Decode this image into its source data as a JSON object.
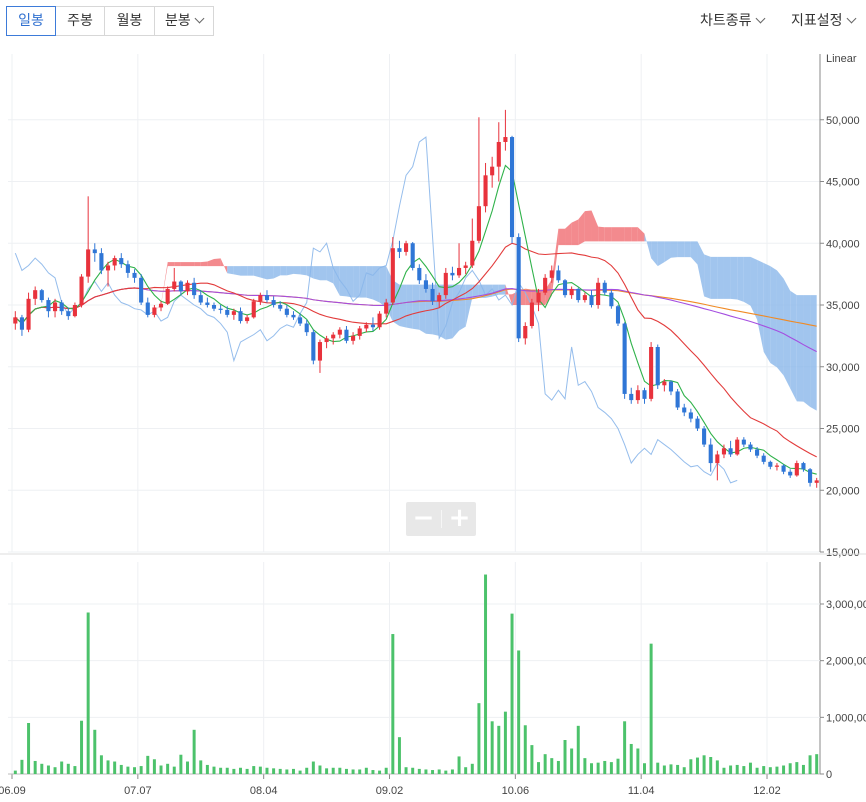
{
  "toolbar": {
    "periods": [
      "일봉",
      "주봉",
      "월봉",
      "분봉"
    ],
    "active_period": "일봉",
    "chart_type_label": "차트종류",
    "indicator_label": "지표설정"
  },
  "zoom": {
    "minus_label": "−",
    "plus_label": "+"
  },
  "colors": {
    "up": "#e8323c",
    "down": "#2f76d6",
    "volume": "#4cc26b",
    "ma5": "#2fb24a",
    "ma20": "#e23b3b",
    "ma60": "#a44ee0",
    "ma120": "#f08a24",
    "cloud_blue": "#8ab6ea",
    "cloud_red": "#f06d72",
    "grid": "#eef0f3"
  },
  "chart_data": [
    {
      "type": "candlestick",
      "scale_label": "Linear",
      "y_ticks": [
        "50,000",
        "45,000",
        "40,000",
        "35,000",
        "30,000",
        "25,000",
        "20,000",
        "15,000"
      ],
      "ylim": [
        15000,
        55000
      ],
      "x_tick_labels": [
        "06.09",
        "07.07",
        "08.04",
        "09.02",
        "10.06",
        "11.04",
        "12.02"
      ],
      "candles": [
        [
          0,
          33500,
          34500,
          33000,
          34000
        ],
        [
          1,
          34000,
          34200,
          32500,
          33000
        ],
        [
          2,
          33000,
          36000,
          32800,
          35500
        ],
        [
          3,
          35500,
          36500,
          35000,
          36200
        ],
        [
          4,
          36200,
          36300,
          35200,
          35400
        ],
        [
          5,
          35400,
          35600,
          34000,
          34500
        ],
        [
          6,
          34500,
          35500,
          34000,
          35200
        ],
        [
          7,
          35200,
          35400,
          34200,
          34500
        ],
        [
          8,
          34500,
          34800,
          33800,
          34100
        ],
        [
          9,
          34100,
          35200,
          34000,
          35000
        ],
        [
          10,
          35000,
          37500,
          34800,
          37300
        ],
        [
          11,
          37300,
          43800,
          36800,
          39500
        ],
        [
          12,
          39500,
          40000,
          38500,
          39200
        ],
        [
          13,
          39200,
          39600,
          37500,
          37800
        ],
        [
          14,
          37800,
          38500,
          36500,
          38200
        ],
        [
          15,
          38200,
          39000,
          37800,
          38800
        ],
        [
          16,
          38800,
          39200,
          38000,
          38300
        ],
        [
          17,
          38300,
          38600,
          37200,
          37600
        ],
        [
          18,
          37600,
          37900,
          36800,
          37200
        ],
        [
          19,
          37200,
          37500,
          35000,
          35200
        ],
        [
          20,
          35200,
          35600,
          34000,
          34200
        ],
        [
          21,
          34200,
          35000,
          34000,
          34800
        ],
        [
          22,
          34800,
          35300,
          34500,
          35100
        ],
        [
          23,
          35100,
          36500,
          35000,
          36300
        ],
        [
          24,
          36300,
          38000,
          36100,
          36900
        ],
        [
          25,
          36900,
          37000,
          35800,
          36100
        ],
        [
          26,
          36100,
          37000,
          35800,
          36800
        ],
        [
          27,
          36800,
          37200,
          35500,
          35800
        ],
        [
          28,
          35800,
          36200,
          35000,
          35200
        ],
        [
          29,
          35200,
          35600,
          34800,
          35000
        ],
        [
          30,
          35000,
          35200,
          34500,
          34700
        ],
        [
          31,
          34700,
          35000,
          34300,
          34600
        ],
        [
          32,
          34600,
          34900,
          34000,
          34200
        ],
        [
          33,
          34200,
          34700,
          33800,
          34500
        ],
        [
          34,
          34500,
          34800,
          33500,
          33700
        ],
        [
          35,
          33700,
          34200,
          33500,
          34000
        ],
        [
          36,
          34000,
          35500,
          33900,
          35300
        ],
        [
          37,
          35300,
          36000,
          35000,
          35800
        ],
        [
          38,
          35800,
          36200,
          35200,
          35400
        ],
        [
          39,
          35400,
          35700,
          34800,
          35000
        ],
        [
          40,
          35000,
          35300,
          34500,
          34700
        ],
        [
          41,
          34700,
          35000,
          34000,
          34200
        ],
        [
          42,
          34200,
          34500,
          33800,
          34000
        ],
        [
          43,
          34000,
          34300,
          33300,
          33500
        ],
        [
          44,
          33500,
          33800,
          32500,
          32800
        ],
        [
          45,
          32800,
          33000,
          30200,
          30500
        ],
        [
          46,
          30500,
          32200,
          29500,
          32000
        ],
        [
          47,
          32000,
          32500,
          31500,
          32300
        ],
        [
          48,
          32300,
          32800,
          31800,
          32600
        ],
        [
          49,
          32600,
          33200,
          32300,
          33000
        ],
        [
          50,
          33000,
          33300,
          31900,
          32100
        ],
        [
          51,
          32100,
          32800,
          31800,
          32500
        ],
        [
          52,
          32500,
          33300,
          32200,
          33100
        ],
        [
          53,
          33100,
          33600,
          32800,
          33400
        ],
        [
          54,
          33400,
          34000,
          32900,
          33200
        ],
        [
          55,
          33200,
          34500,
          33000,
          34300
        ],
        [
          56,
          34300,
          35500,
          34000,
          35200
        ],
        [
          57,
          35200,
          40500,
          35000,
          39600
        ],
        [
          58,
          39600,
          40200,
          38800,
          39300
        ],
        [
          59,
          39300,
          40200,
          39000,
          40000
        ],
        [
          60,
          40000,
          40100,
          37800,
          38000
        ],
        [
          61,
          38000,
          38300,
          36700,
          37000
        ],
        [
          62,
          37000,
          37500,
          36000,
          36300
        ],
        [
          63,
          36300,
          36800,
          35000,
          35300
        ],
        [
          64,
          35300,
          36000,
          34800,
          35800
        ],
        [
          65,
          35800,
          38000,
          35500,
          37600
        ],
        [
          66,
          37600,
          38100,
          37000,
          37400
        ],
        [
          67,
          37400,
          40000,
          37200,
          38000
        ],
        [
          68,
          38000,
          38500,
          37500,
          38200
        ],
        [
          69,
          38200,
          42000,
          38000,
          40200
        ],
        [
          70,
          40200,
          50200,
          40000,
          43000
        ],
        [
          71,
          43000,
          46500,
          42500,
          45500
        ],
        [
          72,
          45500,
          47000,
          44500,
          46200
        ],
        [
          73,
          46200,
          49800,
          45000,
          48200
        ],
        [
          74,
          48200,
          50800,
          47500,
          48600
        ],
        [
          75,
          48600,
          48700,
          40000,
          40500
        ],
        [
          76,
          40500,
          40800,
          32000,
          32300
        ],
        [
          77,
          32300,
          33600,
          31800,
          33300
        ],
        [
          78,
          33300,
          35500,
          33100,
          35200
        ],
        [
          79,
          35200,
          36300,
          34500,
          36000
        ],
        [
          80,
          36000,
          37500,
          35800,
          37200
        ],
        [
          81,
          37200,
          38200,
          36800,
          37800
        ],
        [
          82,
          37800,
          38200,
          36800,
          37000
        ],
        [
          83,
          37000,
          37100,
          35600,
          35800
        ],
        [
          84,
          35800,
          36500,
          35500,
          36300
        ],
        [
          85,
          36300,
          36400,
          35200,
          35400
        ],
        [
          86,
          35400,
          36000,
          35200,
          35800
        ],
        [
          87,
          35800,
          36200,
          34800,
          35000
        ],
        [
          88,
          35000,
          37200,
          34700,
          36800
        ],
        [
          89,
          36800,
          37000,
          35800,
          36000
        ],
        [
          90,
          36000,
          36200,
          34700,
          34900
        ],
        [
          91,
          34900,
          35000,
          33300,
          33500
        ],
        [
          92,
          33500,
          33600,
          27400,
          27800
        ],
        [
          93,
          27800,
          28300,
          27000,
          27300
        ],
        [
          94,
          27300,
          28500,
          27000,
          28100
        ],
        [
          95,
          28100,
          28300,
          27000,
          27400
        ],
        [
          96,
          27400,
          32000,
          27200,
          31600
        ],
        [
          97,
          31600,
          31800,
          28200,
          28500
        ],
        [
          98,
          28500,
          29000,
          28000,
          28800
        ],
        [
          99,
          28800,
          28900,
          27700,
          28000
        ],
        [
          100,
          28000,
          28200,
          26500,
          26700
        ],
        [
          101,
          26700,
          27000,
          26000,
          26300
        ],
        [
          102,
          26300,
          26600,
          25500,
          25800
        ],
        [
          103,
          25800,
          26000,
          24800,
          25000
        ],
        [
          104,
          25000,
          25200,
          23500,
          23700
        ],
        [
          105,
          23700,
          24200,
          21500,
          22200
        ],
        [
          106,
          22200,
          23200,
          20800,
          22900
        ],
        [
          107,
          22900,
          23700,
          22600,
          23400
        ],
        [
          108,
          23400,
          24000,
          22700,
          22900
        ],
        [
          109,
          22900,
          24300,
          22800,
          24100
        ],
        [
          110,
          24100,
          24300,
          23500,
          23700
        ],
        [
          111,
          23700,
          23900,
          23100,
          23300
        ],
        [
          112,
          23300,
          23500,
          22600,
          22800
        ],
        [
          113,
          22800,
          23000,
          22100,
          22300
        ],
        [
          114,
          22300,
          22400,
          21700,
          21900
        ],
        [
          115,
          21900,
          22200,
          21600,
          22000
        ],
        [
          116,
          22000,
          22100,
          21300,
          21500
        ],
        [
          117,
          21500,
          21700,
          21000,
          21200
        ],
        [
          118,
          21200,
          22400,
          21100,
          22200
        ],
        [
          119,
          22200,
          22300,
          21500,
          21700
        ],
        [
          120,
          21700,
          21800,
          20300,
          20600
        ],
        [
          121,
          20600,
          21000,
          20200,
          20800
        ]
      ],
      "volumes": [
        60,
        250,
        900,
        230,
        180,
        150,
        120,
        220,
        180,
        140,
        940,
        2850,
        780,
        330,
        240,
        220,
        160,
        130,
        120,
        140,
        320,
        260,
        150,
        180,
        130,
        340,
        220,
        780,
        240,
        160,
        130,
        110,
        110,
        90,
        110,
        90,
        140,
        130,
        110,
        100,
        90,
        80,
        90,
        60,
        110,
        220,
        150,
        100,
        110,
        110,
        90,
        80,
        80,
        110,
        70,
        60,
        110,
        2470,
        650,
        120,
        110,
        90,
        80,
        70,
        80,
        60,
        80,
        310,
        120,
        180,
        1250,
        3520,
        930,
        850,
        1100,
        2830,
        2180,
        860,
        510,
        210,
        350,
        280,
        230,
        600,
        450,
        850,
        280,
        190,
        200,
        230,
        210,
        270,
        930,
        530,
        450,
        190,
        2300,
        200,
        150,
        170,
        160,
        120,
        260,
        290,
        330,
        300,
        240,
        110,
        150,
        160,
        140,
        200,
        110,
        140,
        120,
        130,
        150,
        190,
        210,
        160,
        330,
        350
      ],
      "volume_ticks": [
        "3,000,00",
        "2,000,00",
        "1,000,00",
        "0"
      ]
    }
  ]
}
